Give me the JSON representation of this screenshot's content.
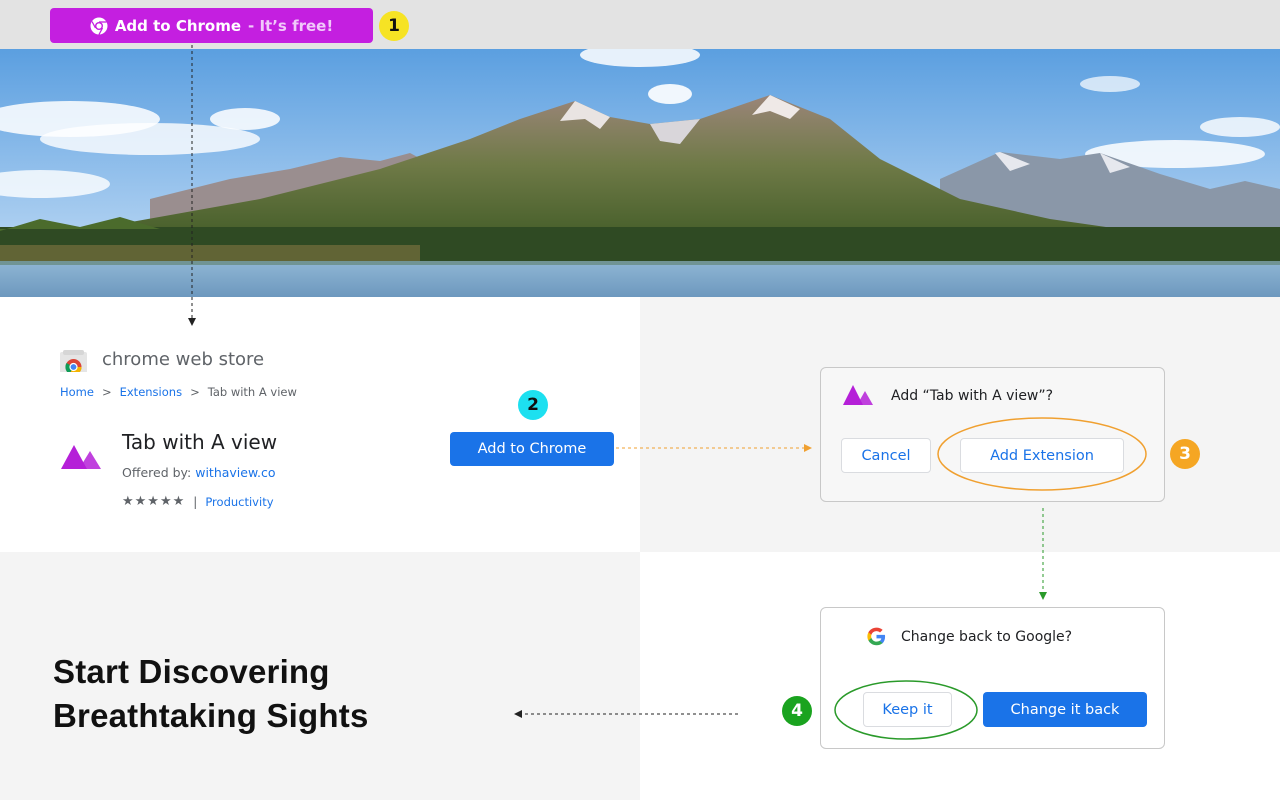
{
  "top_cta": {
    "label": "Add to Chrome",
    "suffix": "- It’s free!",
    "step": "1",
    "colors": {
      "bg": "#c41fe0",
      "step_bg": "#f6e324"
    }
  },
  "store": {
    "title": "chrome web store",
    "breadcrumb": [
      "Home",
      ">",
      "Extensions",
      ">",
      "Tab with A view"
    ],
    "extension_name": "Tab with A view",
    "offered_label": "Offered by:",
    "offered_by": "withaview.co",
    "stars": "★★★★★",
    "rating_value": 5,
    "separator": "|",
    "category": "Productivity",
    "add_button": "Add to Chrome",
    "step": "2",
    "step_color": "#1de0f0"
  },
  "add_dialog": {
    "title": "Add “Tab with A view”?",
    "cancel": "Cancel",
    "confirm": "Add Extension",
    "step": "3",
    "step_color": "#f5a623"
  },
  "google_dialog": {
    "title": "Change back to Google?",
    "keep": "Keep it",
    "change": "Change it back",
    "step": "4",
    "step_color": "#1aa31f"
  },
  "headline": {
    "line1": "Start Discovering",
    "line2": "Breathtaking Sights"
  },
  "icons": [
    "chrome-logo-icon",
    "chrome-web-store-icon",
    "tab-with-a-view-logo-icon",
    "google-g-icon",
    "star-icon"
  ],
  "colors": {
    "accent": "#1a73e8",
    "brand_purple": "#b520d8",
    "annotation_orange": "#f0a030",
    "annotation_green": "#3a9a3a"
  }
}
